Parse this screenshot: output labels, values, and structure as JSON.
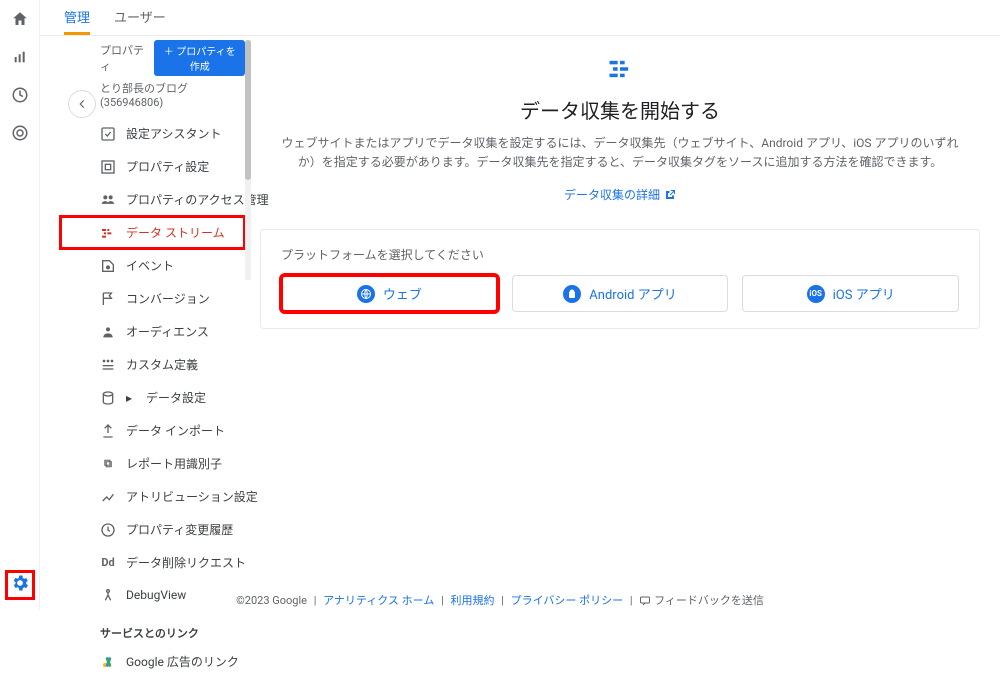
{
  "tabs": {
    "admin": "管理",
    "user": "ユーザー"
  },
  "sidebar": {
    "property_label": "プロパティ",
    "create_btn": "＋ プロパティを作成",
    "property_name": "とり部長のブログ (356946806)",
    "items": [
      {
        "label": "設定アシスタント"
      },
      {
        "label": "プロパティ設定"
      },
      {
        "label": "プロパティのアクセス管理"
      },
      {
        "label": "データ ストリーム"
      },
      {
        "label": "イベント"
      },
      {
        "label": "コンバージョン"
      },
      {
        "label": "オーディエンス"
      },
      {
        "label": "カスタム定義"
      },
      {
        "label": "データ設定"
      },
      {
        "label": "データ インポート"
      },
      {
        "label": "レポート用識別子"
      },
      {
        "label": "アトリビューション設定"
      },
      {
        "label": "プロパティ変更履歴"
      },
      {
        "label": "データ削除リクエスト"
      },
      {
        "label": "DebugView"
      }
    ],
    "group_label": "サービスとのリンク",
    "ads_link": "Google 広告のリンク"
  },
  "hero": {
    "title": "データ収集を開始する",
    "desc": "ウェブサイトまたはアプリでデータ収集を設定するには、データ収集先（ウェブサイト、Android アプリ、iOS アプリのいずれか）を指定する必要があります。データ収集先を指定すると、データ収集タグをソースに追加する方法を確認できます。",
    "link": "データ収集の詳細"
  },
  "platform": {
    "label": "プラットフォームを選択してください",
    "web": "ウェブ",
    "android": "Android アプリ",
    "ios": "iOS アプリ"
  },
  "footer": {
    "copyright": "©2023 Google",
    "home": "アナリティクス ホーム",
    "terms": "利用規約",
    "privacy": "プライバシー ポリシー",
    "feedback": "フィードバックを送信"
  }
}
